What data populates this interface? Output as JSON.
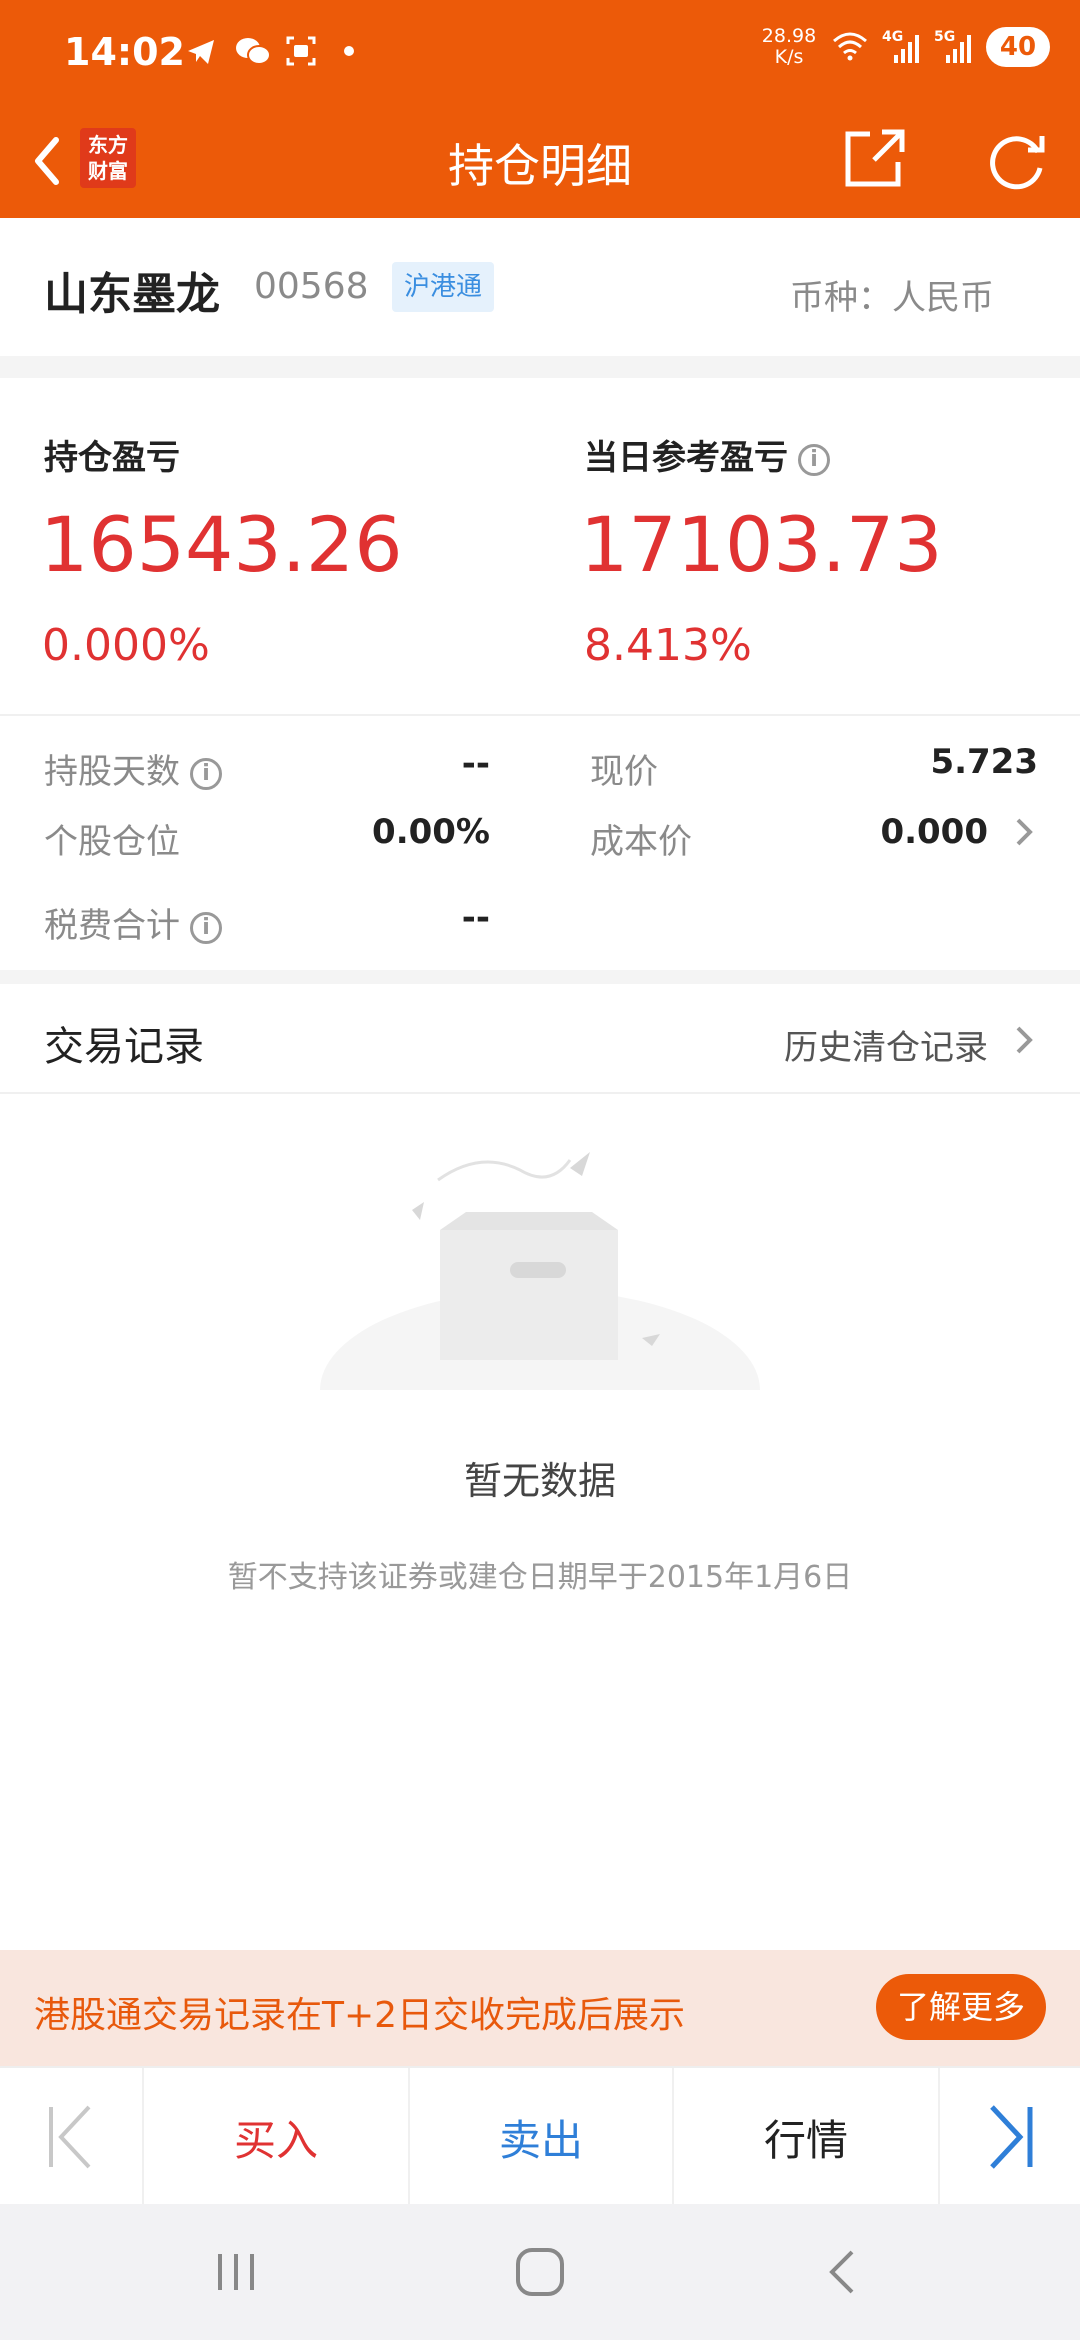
{
  "status_bar": {
    "time": "14:02",
    "net_speed_value": "28.98",
    "net_speed_unit": "K/s",
    "network_4g": "4G",
    "network_5g": "5G",
    "battery": "40"
  },
  "header": {
    "logo_line1": "东方",
    "logo_line2": "财富",
    "title": "持仓明细"
  },
  "stock": {
    "name": "山东墨龙",
    "code": "00568",
    "tag": "沪港通",
    "currency": "币种：人民币"
  },
  "pnl": {
    "holding_label": "持仓盈亏",
    "holding_value": "16543.26",
    "holding_pct": "0.000%",
    "daily_label": "当日参考盈亏",
    "daily_value": "17103.73",
    "daily_pct": "8.413%"
  },
  "details": {
    "days_label": "持股天数",
    "days_value": "--",
    "price_label": "现价",
    "price_value": "5.723",
    "position_label": "个股仓位",
    "position_value": "0.00%",
    "cost_label": "成本价",
    "cost_value": "0.000",
    "fee_label": "税费合计",
    "fee_value": "--"
  },
  "records": {
    "title": "交易记录",
    "history_link": "历史清仓记录",
    "empty_title": "暂无数据",
    "empty_subtitle": "暂不支持该证券或建仓日期早于2015年1月6日"
  },
  "notice": {
    "text": "港股通交易记录在T+2日交收完成后展示",
    "button": "了解更多"
  },
  "actions": {
    "buy": "买入",
    "sell": "卖出",
    "quote": "行情"
  },
  "colors": {
    "brand": "#ec5a09",
    "gain": "#e03232",
    "sell": "#2f7fd8"
  }
}
